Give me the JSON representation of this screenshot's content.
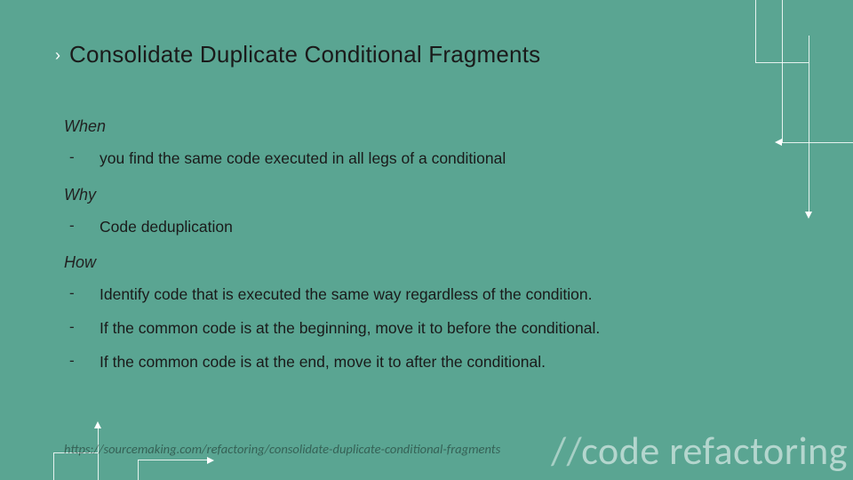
{
  "title": {
    "bullet": "›",
    "text": "Consolidate Duplicate Conditional Fragments"
  },
  "sections": {
    "when": {
      "label": "When",
      "items": [
        "you find the same code executed in all legs of a conditional"
      ]
    },
    "why": {
      "label": "Why",
      "items": [
        "Code deduplication"
      ]
    },
    "how": {
      "label": "How",
      "items": [
        "Identify code that is executed the same way regardless of the condition.",
        "If the common code is at the beginning, move it to before the conditional.",
        "If the common code is at the end, move it to after the conditional."
      ]
    }
  },
  "footer": {
    "url": "https://sourcemaking.com/refactoring/consolidate-duplicate-conditional-fragments"
  },
  "watermark": {
    "slashes": "//",
    "word1": "code",
    "word2": "refactoring"
  }
}
